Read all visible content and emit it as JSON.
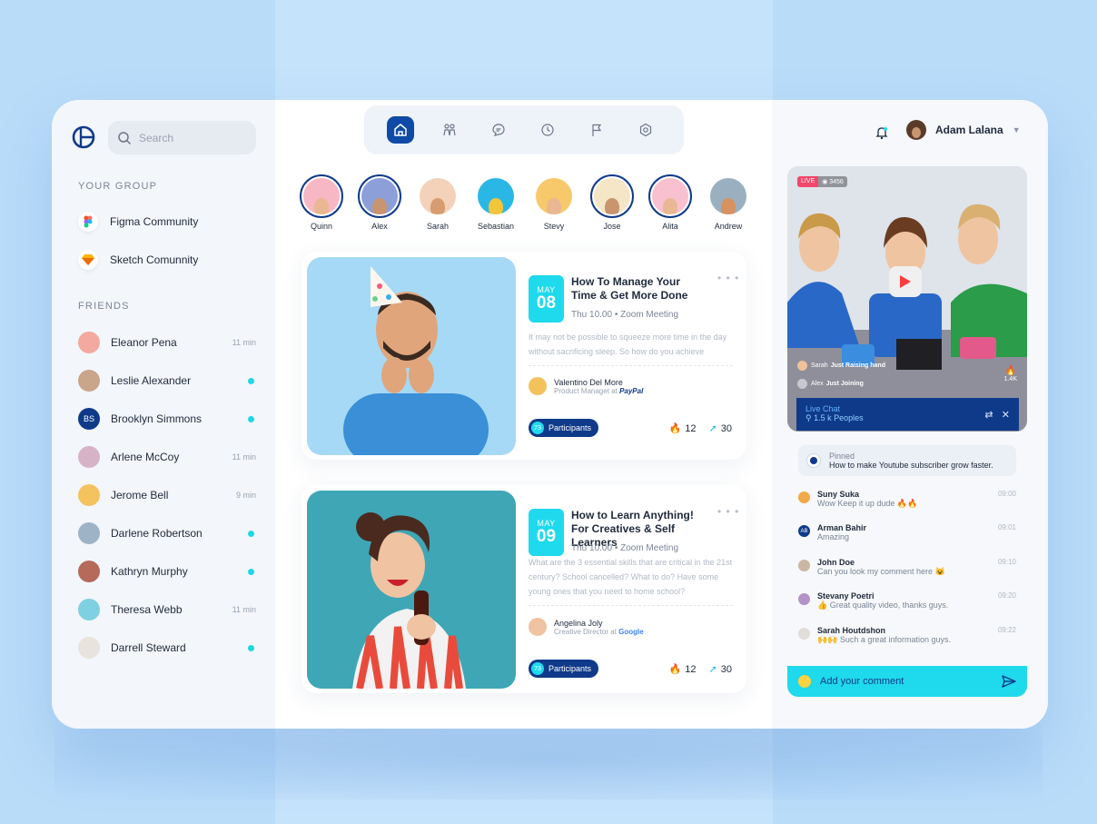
{
  "search": {
    "placeholder": "Search"
  },
  "sidebar": {
    "group_title": "YOUR GROUP",
    "groups": [
      {
        "label": "Figma Community",
        "icon": "figma-icon"
      },
      {
        "label": "Sketch Comunnity",
        "icon": "sketch-icon"
      }
    ],
    "friends_title": "FRIENDS",
    "friends": [
      {
        "name": "Eleanor Pena",
        "time": "11 min",
        "online": false
      },
      {
        "name": "Leslie Alexander",
        "time": "",
        "online": true
      },
      {
        "name": "Brooklyn Simmons",
        "time": "",
        "online": true,
        "initials": "BS"
      },
      {
        "name": "Arlene McCoy",
        "time": "11 min",
        "online": false
      },
      {
        "name": "Jerome Bell",
        "time": "9 min",
        "online": false
      },
      {
        "name": "Darlene Robertson",
        "time": "",
        "online": true
      },
      {
        "name": "Kathryn Murphy",
        "time": "",
        "online": true
      },
      {
        "name": "Theresa Webb",
        "time": "11 min",
        "online": false
      },
      {
        "name": "Darrell Steward",
        "time": "",
        "online": true
      }
    ]
  },
  "nav": {
    "items": [
      "home-icon",
      "people-icon",
      "chat-icon",
      "clock-icon",
      "flag-icon",
      "settings-icon"
    ]
  },
  "stories": [
    "Quinn",
    "Alex",
    "Sarah",
    "Sebastian",
    "Stevy",
    "Jose",
    "Alita",
    "Andrew"
  ],
  "events": [
    {
      "month": "MAY",
      "day": "08",
      "title": "How To Manage Your Time & Get More Done",
      "meta": "Thu 10.00 • Zoom Meeting",
      "desc": "It may not be possible to squeeze more time in the day without sacrificing sleep. So how do you achieve",
      "host_name": "Valentino Del More",
      "host_role": "Product Managet at",
      "host_company": "PayPal",
      "participants_count": "73",
      "participants_label": "Participants",
      "fire": "12",
      "shares": "30"
    },
    {
      "month": "MAY",
      "day": "09",
      "title": "How to Learn Anything! For Creatives & Self Learners",
      "meta": "Thu 10.00 • Zoom Meeting",
      "desc": "What are the 3 essential skills that are critical in the 21st century? School cancelled? What to do? Have some young ones that you need to home school?",
      "host_name": "Angelina Joly",
      "host_role": "Creative Director at",
      "host_company": "Google",
      "participants_count": "73",
      "participants_label": "Participants",
      "fire": "12",
      "shares": "30"
    }
  ],
  "profile": {
    "name": "Adam Lalana"
  },
  "live": {
    "badge": "LIVE",
    "viewers": "3456",
    "join1_name": "Sarah",
    "join1_text": "Just Raising hand",
    "join2_name": "Alex",
    "join2_text": "Just Joining",
    "likes": "1.4K",
    "chat_title": "Live Chat",
    "chat_people": "1.5 k Peoples"
  },
  "pinned": {
    "label": "Pinned",
    "text": "How to make Youtube subscriber grow faster."
  },
  "messages": [
    {
      "name": "Suny Suka",
      "text": "Wow Keep it up dude 🔥🔥",
      "time": "09:00"
    },
    {
      "name": "Arman Bahir",
      "text": "Amazing",
      "time": "09:01",
      "initials": "AB"
    },
    {
      "name": "John Doe",
      "text": "Can you look my comment here 😺",
      "time": "09:10"
    },
    {
      "name": "Stevany Poetri",
      "text": "👍 Great quality video, thanks guys.",
      "time": "09:20"
    },
    {
      "name": "Sarah Houtdshon",
      "text": "🙌🙌 Such a great information guys.",
      "time": "09:22"
    }
  ],
  "comment": {
    "placeholder": "Add your comment"
  },
  "colors": {
    "primary": "#0f3a8a",
    "accent": "#1fd9ec",
    "live": "#f2466b"
  }
}
